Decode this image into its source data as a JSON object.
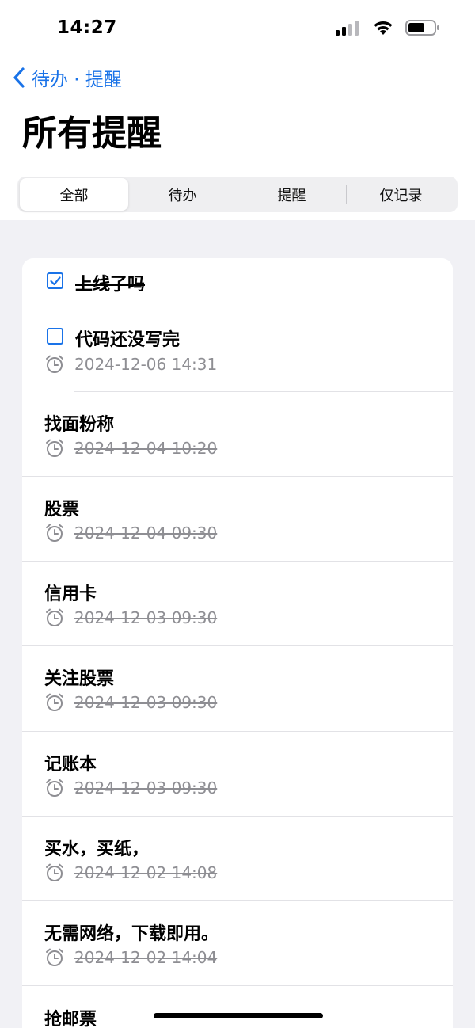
{
  "status_bar": {
    "time": "14:27"
  },
  "nav": {
    "back_label": "待办 · 提醒"
  },
  "page": {
    "title": "所有提醒"
  },
  "tabs": [
    "全部",
    "待办",
    "提醒",
    "仅记录"
  ],
  "colors": {
    "accent": "#1a73e8",
    "secondary_text": "#8e8e93",
    "background": "#f1f1f5"
  },
  "items": [
    {
      "title": "上线了吗",
      "checkbox": "checked",
      "title_done": true
    },
    {
      "title": "代码还没写完",
      "checkbox": "unchecked",
      "date": "2024-12-06 14:31",
      "date_done": false
    },
    {
      "title": "找面粉称",
      "date": "2024-12-04 10:20",
      "date_done": true
    },
    {
      "title": "股票",
      "date": "2024-12-04 09:30",
      "date_done": true
    },
    {
      "title": "信用卡",
      "date": "2024-12-03 09:30",
      "date_done": true
    },
    {
      "title": "关注股票",
      "date": "2024-12-03 09:30",
      "date_done": true
    },
    {
      "title": "记账本",
      "date": "2024-12-03 09:30",
      "date_done": true
    },
    {
      "title": "买水，买纸，",
      "date": "2024-12-02 14:08",
      "date_done": true
    },
    {
      "title": "无需网络，下载即用。",
      "date": "2024-12-02 14:04",
      "date_done": true
    },
    {
      "title": "抢邮票"
    }
  ]
}
